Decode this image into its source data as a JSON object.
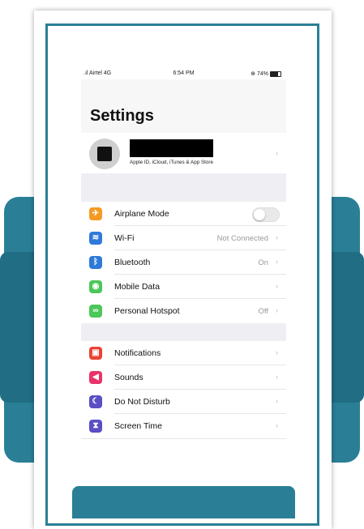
{
  "status_bar": {
    "carrier": "Airtel 4G",
    "time": "6:54 PM",
    "battery": "74%"
  },
  "page_title": "Settings",
  "profile": {
    "subtitle": "Apple ID, iCloud, iTunes & App Store"
  },
  "group1": [
    {
      "label": "Airplane Mode",
      "icon": "airplane-icon",
      "color": "#f59a23",
      "glyph": "✈",
      "value": "",
      "toggle": false
    },
    {
      "label": "Wi-Fi",
      "icon": "wifi-icon",
      "color": "#2f7ad9",
      "glyph": "≋",
      "value": "Not Connected"
    },
    {
      "label": "Bluetooth",
      "icon": "bluetooth-icon",
      "color": "#2f7ad9",
      "glyph": "ᛒ",
      "value": "On"
    },
    {
      "label": "Mobile Data",
      "icon": "antenna-icon",
      "color": "#4cc75a",
      "glyph": "◉",
      "value": ""
    },
    {
      "label": "Personal Hotspot",
      "icon": "hotspot-icon",
      "color": "#4cc75a",
      "glyph": "∞",
      "value": "Off"
    }
  ],
  "group2": [
    {
      "label": "Notifications",
      "icon": "notifications-icon",
      "color": "#e94235",
      "glyph": "▣",
      "value": ""
    },
    {
      "label": "Sounds",
      "icon": "speaker-icon",
      "color": "#e9336a",
      "glyph": "◀",
      "value": ""
    },
    {
      "label": "Do Not Disturb",
      "icon": "moon-icon",
      "color": "#5b4fc5",
      "glyph": "☾",
      "value": ""
    },
    {
      "label": "Screen Time",
      "icon": "hourglass-icon",
      "color": "#5b4fc5",
      "glyph": "⧗",
      "value": ""
    }
  ],
  "chevron": "›",
  "colors": {
    "accent_teal": "#2a7f97",
    "group_bg": "#efeff3"
  }
}
